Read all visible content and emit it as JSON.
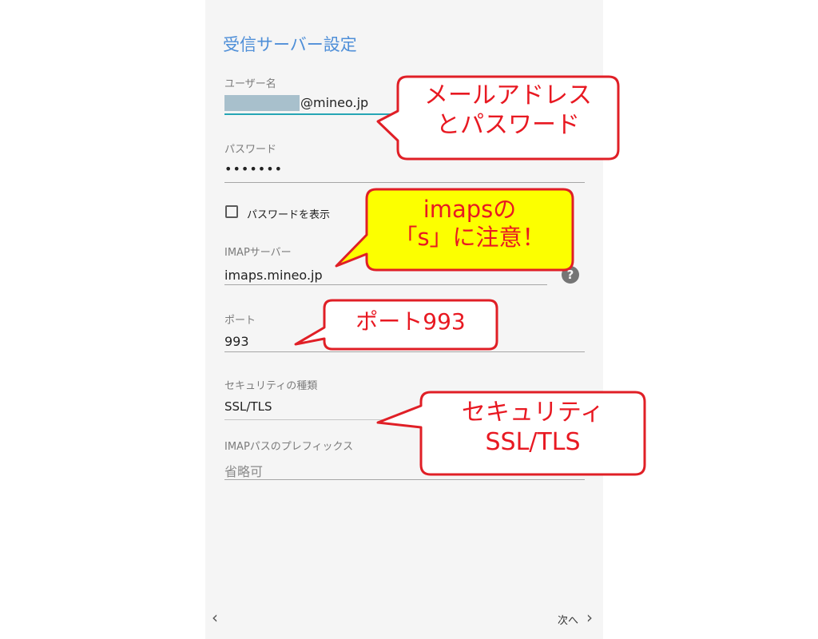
{
  "screen": {
    "title": "受信サーバー設定"
  },
  "fields": {
    "username": {
      "label": "ユーザー名",
      "value": "@mineo.jp"
    },
    "password": {
      "label": "パスワード",
      "value": "•••••••"
    },
    "show_password": {
      "label": "パスワードを表示",
      "checked": false
    },
    "imap_server": {
      "label": "IMAPサーバー",
      "value": "imaps.mineo.jp"
    },
    "port": {
      "label": "ポート",
      "value": "993"
    },
    "security": {
      "label": "セキュリティの種類",
      "value": "SSL/TLS"
    },
    "imap_prefix": {
      "label": "IMAPパスのプレフィックス",
      "placeholder": "省略可"
    }
  },
  "help_icon": {
    "glyph": "?"
  },
  "nav": {
    "back_glyph": "‹",
    "next_label": "次へ",
    "next_glyph": "›"
  },
  "callouts": {
    "mail": {
      "line1": "メールアドレス",
      "line2": "とパスワード"
    },
    "imaps": {
      "line1": "imapsの",
      "line2": "「s」に注意！"
    },
    "port": {
      "line1": "ポート993"
    },
    "security": {
      "line1": "セキュリティ",
      "line2": "SSL/TLS"
    }
  },
  "colors": {
    "accent": "#4f8fd8",
    "callout_border": "#e01f26",
    "callout_text": "#e81922",
    "highlight_fill": "#fcff00",
    "underline_active": "#26a6b5"
  }
}
